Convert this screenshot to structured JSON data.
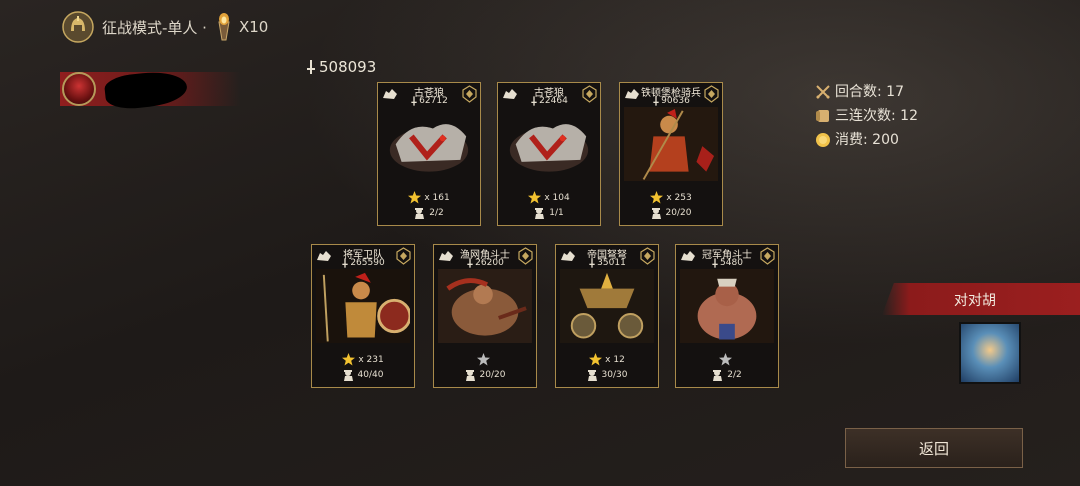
{
  "header": {
    "mode_label": "征战模式-单人 ·",
    "multiplier": "X10"
  },
  "player": {
    "total_power": "508093"
  },
  "stats": {
    "rounds_label": "回合数: 17",
    "triples_label": "三连次数: 12",
    "cost_label": "消费: 200"
  },
  "cards": [
    {
      "name": "古苍狼",
      "power": "62712",
      "stars": "x 161",
      "count": "2/2",
      "art": "wolf"
    },
    {
      "name": "古苍狼",
      "power": "22464",
      "stars": "x 104",
      "count": "1/1",
      "art": "wolf"
    },
    {
      "name": "铁顿堡枪骑兵",
      "power": "90636",
      "stars": "x 253",
      "count": "20/20",
      "art": "spearman"
    },
    {
      "name": "将军卫队",
      "power": "265590",
      "stars": "x 231",
      "count": "40/40",
      "art": "guard"
    },
    {
      "name": "渔网角斗士",
      "power": "26200",
      "stars": "",
      "count": "20/20",
      "art": "gladiator"
    },
    {
      "name": "帝国弩弩",
      "power": "35011",
      "stars": "x 12",
      "count": "30/30",
      "art": "ballista"
    },
    {
      "name": "冠军角斗士",
      "power": "5480",
      "stars": "",
      "count": "2/2",
      "art": "champion"
    }
  ],
  "opponent": {
    "name": "对对胡"
  },
  "buttons": {
    "back": "返回"
  },
  "colors": {
    "gold": "#a88a4a",
    "accent_red": "#9b1f1f",
    "star": "#f2c230"
  }
}
